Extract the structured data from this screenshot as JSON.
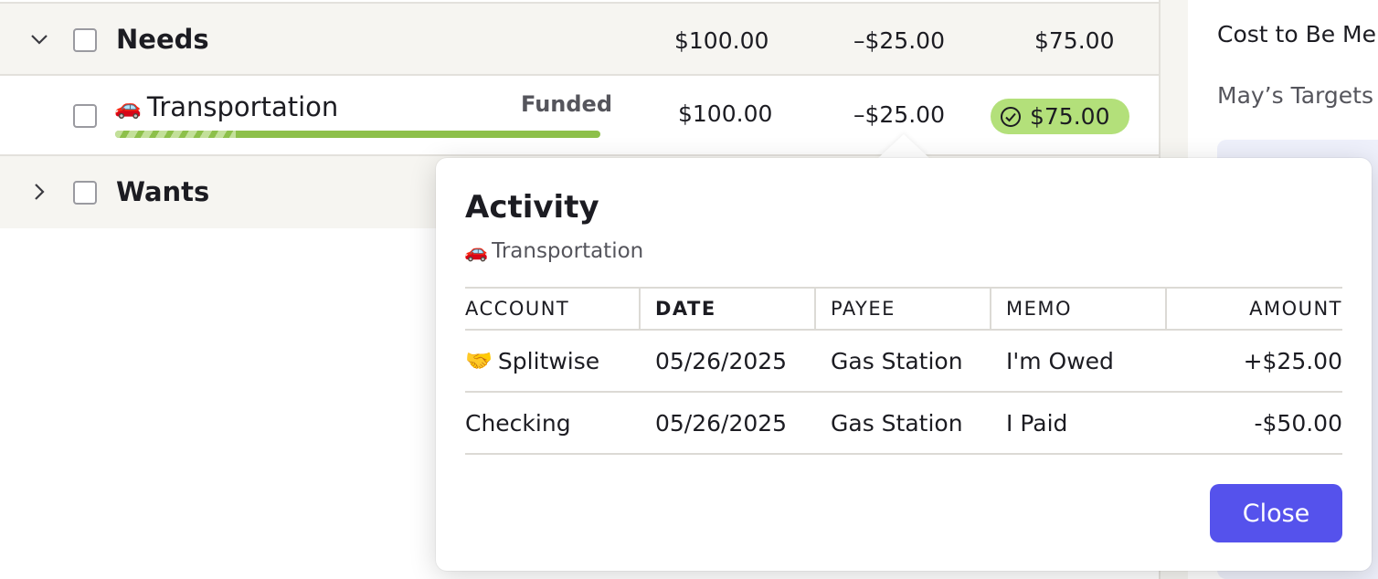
{
  "budget": {
    "groups": [
      {
        "name": "Needs",
        "assigned": "$100.00",
        "activity": "–$25.00",
        "available": "$75.00",
        "expanded": true
      },
      {
        "name": "Wants",
        "expanded": false
      }
    ],
    "category": {
      "emoji": "🚗",
      "name": "Transportation",
      "status": "Funded",
      "assigned": "$100.00",
      "activity": "–$25.00",
      "available": "$75.00",
      "progress_percent": 100,
      "status_color": "#b3e07a"
    }
  },
  "right_pane": {
    "heading": "Cost to Be Me",
    "subheading": "May’s Targets"
  },
  "popover": {
    "title": "Activity",
    "category_emoji": "🚗",
    "category_name": "Transportation",
    "columns": [
      "ACCOUNT",
      "DATE",
      "PAYEE",
      "MEMO",
      "AMOUNT"
    ],
    "rows": [
      {
        "account_emoji": "🤝",
        "account": "Splitwise",
        "date": "05/26/2025",
        "payee": "Gas Station",
        "memo": "I'm Owed",
        "amount": "+$25.00"
      },
      {
        "account_emoji": "",
        "account": "Checking",
        "date": "05/26/2025",
        "payee": "Gas Station",
        "memo": "I Paid",
        "amount": "-$50.00"
      }
    ],
    "close_label": "Close",
    "accent_color": "#5552ec"
  }
}
